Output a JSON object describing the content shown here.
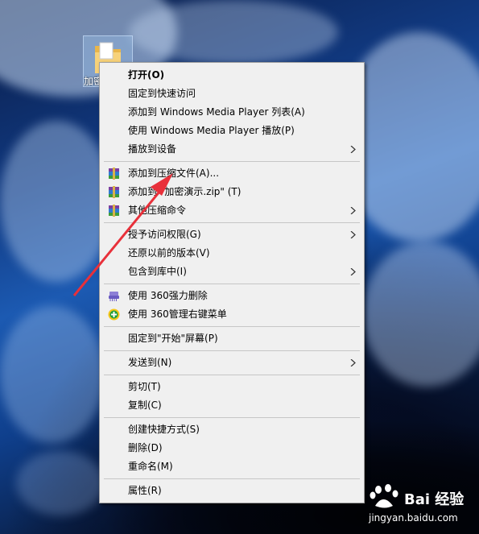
{
  "desktop": {
    "folder_label": "加密"
  },
  "context_menu": {
    "items": [
      {
        "label": "打开(O)",
        "bold": true
      },
      {
        "label": "固定到快速访问"
      },
      {
        "label": "添加到 Windows Media Player 列表(A)"
      },
      {
        "label": "使用 Windows Media Player 播放(P)"
      },
      {
        "label": "播放到设备",
        "submenu": true
      },
      {
        "label": "添加到压缩文件(A)...",
        "icon": "winrar-icon"
      },
      {
        "label": "添加到 \"加密演示.zip\" (T)",
        "icon": "winrar-icon"
      },
      {
        "label": "其他压缩命令",
        "icon": "winrar-icon",
        "submenu": true
      },
      {
        "label": "授予访问权限(G)",
        "submenu": true
      },
      {
        "label": "还原以前的版本(V)"
      },
      {
        "label": "包含到库中(I)",
        "submenu": true
      },
      {
        "label": "使用 360强力删除",
        "icon": "shredder-icon"
      },
      {
        "label": "使用 360管理右键菜单",
        "icon": "360-plus-icon"
      },
      {
        "label": "固定到\"开始\"屏幕(P)"
      },
      {
        "label": "发送到(N)",
        "submenu": true
      },
      {
        "label": "剪切(T)"
      },
      {
        "label": "复制(C)"
      },
      {
        "label": "创建快捷方式(S)"
      },
      {
        "label": "删除(D)"
      },
      {
        "label": "重命名(M)"
      },
      {
        "label": "属性(R)"
      }
    ]
  },
  "annotation": {
    "color": "#e8303a",
    "points_to": "添加到压缩文件(A)..."
  },
  "watermark": {
    "brand": "Bai 经验",
    "url": "jingyan.baidu.com"
  }
}
